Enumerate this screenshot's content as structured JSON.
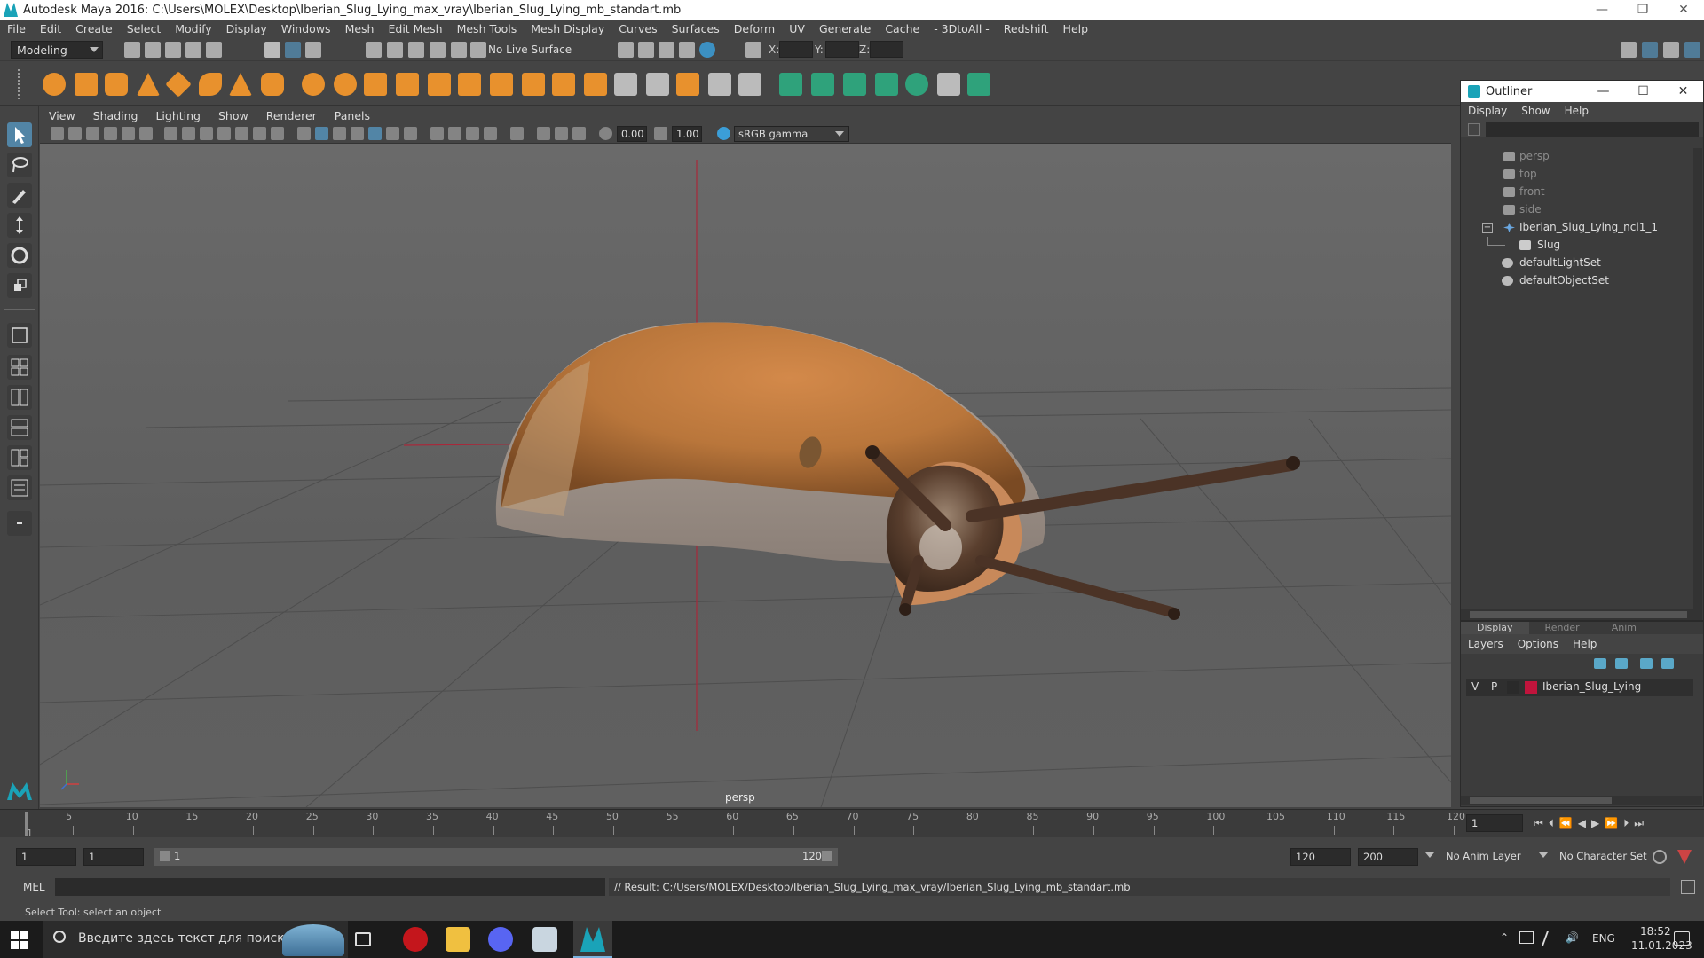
{
  "window": {
    "title": "Autodesk Maya 2016: C:\\Users\\MOLEX\\Desktop\\Iberian_Slug_Lying_max_vray\\Iberian_Slug_Lying_mb_standart.mb",
    "controls": [
      "—",
      "❐",
      "✕"
    ]
  },
  "menubar": [
    "File",
    "Edit",
    "Create",
    "Select",
    "Modify",
    "Display",
    "Windows",
    "Mesh",
    "Edit Mesh",
    "Mesh Tools",
    "Mesh Display",
    "Curves",
    "Surfaces",
    "Deform",
    "UV",
    "Generate",
    "Cache",
    "- 3DtoAll -",
    "Redshift",
    "Help"
  ],
  "status_line": {
    "mode": "Modeling",
    "live_surface": "No Live Surface",
    "x_label": "X:",
    "y_label": "Y:",
    "z_label": "Z:"
  },
  "viewport_menu": [
    "View",
    "Shading",
    "Lighting",
    "Show",
    "Renderer",
    "Panels"
  ],
  "viewport_toolbar": {
    "exposure": "0.00",
    "gamma": "1.00",
    "color_space": "sRGB gamma"
  },
  "viewport": {
    "camera_label": "persp"
  },
  "outliner": {
    "title": "Outliner",
    "menu": [
      "Display",
      "Show",
      "Help"
    ],
    "items": [
      {
        "label": "persp",
        "dim": true,
        "icon": "camera-icon"
      },
      {
        "label": "top",
        "dim": true,
        "icon": "camera-icon"
      },
      {
        "label": "front",
        "dim": true,
        "icon": "camera-icon"
      },
      {
        "label": "side",
        "dim": true,
        "icon": "camera-icon"
      },
      {
        "label": "Iberian_Slug_Lying_ncl1_1",
        "dim": false,
        "icon": "group-icon"
      },
      {
        "label": "Slug",
        "dim": false,
        "icon": "mesh-icon"
      },
      {
        "label": "defaultLightSet",
        "dim": false,
        "icon": "set-icon"
      },
      {
        "label": "defaultObjectSet",
        "dim": false,
        "icon": "set-icon"
      }
    ]
  },
  "layers": {
    "tabs": [
      "Display",
      "Render",
      "Anim"
    ],
    "menu": [
      "Layers",
      "Options",
      "Help"
    ],
    "row": {
      "v": "V",
      "p": "P",
      "name": "Iberian_Slug_Lying",
      "color": "#c0143c"
    }
  },
  "timeline": {
    "ticks": [
      "1",
      "5",
      "10",
      "15",
      "20",
      "25",
      "30",
      "35",
      "40",
      "45",
      "50",
      "55",
      "60",
      "65",
      "70",
      "75",
      "80",
      "85",
      "90",
      "95",
      "100",
      "105",
      "110",
      "115",
      "120"
    ],
    "current_frame": "1"
  },
  "range": {
    "start": "1",
    "playback_start": "1",
    "slider_start": "1",
    "slider_end": "120",
    "playback_end": "120",
    "end": "200",
    "anim_layer": "No Anim Layer",
    "character_set": "No Character Set"
  },
  "command": {
    "lang": "MEL",
    "result": "// Result: C:/Users/MOLEX/Desktop/Iberian_Slug_Lying_max_vray/Iberian_Slug_Lying_mb_standart.mb"
  },
  "help_line": "Select Tool: select an object",
  "taskbar": {
    "search_placeholder": "Введите здесь текст для поиска",
    "lang": "ENG",
    "time": "18:52",
    "date": "11.01.2023"
  },
  "colors": {
    "accent": "#5285a6",
    "maya_teal": "#1aa3b8",
    "layer_red": "#c0143c"
  }
}
